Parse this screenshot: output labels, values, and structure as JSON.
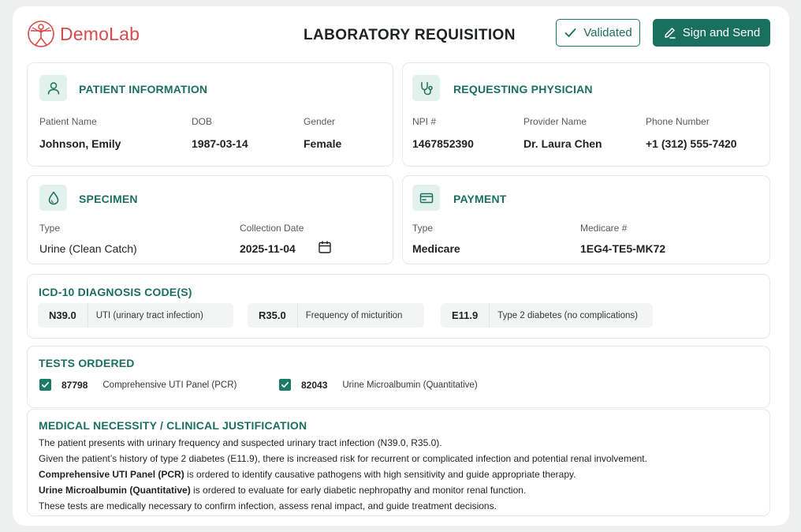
{
  "header": {
    "logo_text": "DemoLab",
    "title": "LABORATORY REQUISITION",
    "validated_label": "Validated",
    "sign_send_label": "Sign and Send"
  },
  "patient": {
    "title": "PATIENT INFORMATION",
    "name_label": "Patient Name",
    "name": "Johnson, Emily",
    "dob_label": "DOB",
    "dob": "1987-03-14",
    "gender_label": "Gender",
    "gender": "Female"
  },
  "physician": {
    "title": "REQUESTING PHYSICIAN",
    "npi_label": "NPI #",
    "npi": "1467852390",
    "provider_label": "Provider Name",
    "provider": "Dr. Laura Chen",
    "phone_label": "Phone Number",
    "phone": "+1 (312) 555-7420"
  },
  "specimen": {
    "title": "SPECIMEN",
    "type_label": "Type",
    "type": "Urine (Clean Catch)",
    "date_label": "Collection Date",
    "date": "2025-11-04"
  },
  "payment": {
    "title": "PAYMENT",
    "type_label": "Type",
    "type": "Medicare",
    "medicare_label": "Medicare #",
    "medicare": "1EG4-TE5-MK72"
  },
  "diagnosis": {
    "title": "ICD-10 DIAGNOSIS CODE(S)",
    "codes": [
      {
        "code": "N39.0",
        "desc": "UTI (urinary tract infection)"
      },
      {
        "code": "R35.0",
        "desc": "Frequency of micturition"
      },
      {
        "code": "E11.9",
        "desc": "Type 2 diabetes (no complications)"
      }
    ]
  },
  "tests": {
    "title": "TESTS ORDERED",
    "items": [
      {
        "code": "87798",
        "name": "Comprehensive UTI Panel (PCR)",
        "checked": true
      },
      {
        "code": "82043",
        "name": "Urine Microalbumin (Quantitative)",
        "checked": true
      }
    ]
  },
  "justification": {
    "title": "MEDICAL NECESSITY / CLINICAL JUSTIFICATION",
    "line1": "The patient presents with urinary frequency and suspected urinary tract infection (N39.0, R35.0).",
    "line2": "Given the patient’s history of type 2 diabetes (E11.9), there is increased risk for recurrent or complicated infection and potential renal involvement.",
    "line3_bold": "Comprehensive UTI Panel (PCR)",
    "line3_rest": " is ordered to identify causative pathogens with high sensitivity and guide appropriate therapy.",
    "line4_bold": "Urine Microalbumin (Quantitative)",
    "line4_rest": " is ordered to evaluate for early diabetic nephropathy and monitor renal function.",
    "line5": "These tests are medically necessary to confirm infection, assess renal impact, and guide treatment decisions."
  },
  "colors": {
    "accent": "#1c6f5f",
    "accent_light": "#e3f1ed",
    "logo": "#d94a4a"
  }
}
